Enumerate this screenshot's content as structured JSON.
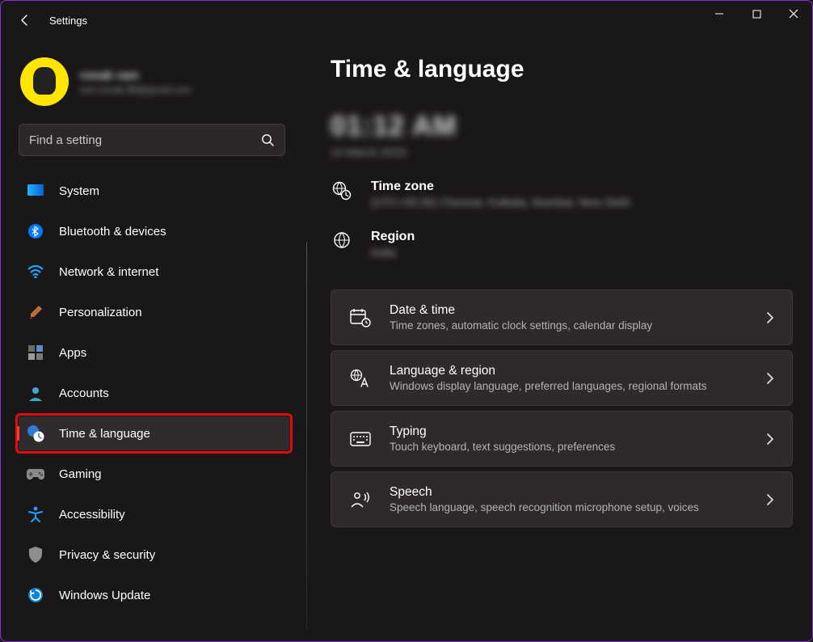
{
  "app": {
    "title": "Settings"
  },
  "user": {
    "name": "ronak ram",
    "email": "ram.ronak.98@gmail.com"
  },
  "search": {
    "placeholder": "Find a setting"
  },
  "sidebar": {
    "items": [
      {
        "label": "System"
      },
      {
        "label": "Bluetooth & devices"
      },
      {
        "label": "Network & internet"
      },
      {
        "label": "Personalization"
      },
      {
        "label": "Apps"
      },
      {
        "label": "Accounts"
      },
      {
        "label": "Time & language"
      },
      {
        "label": "Gaming"
      },
      {
        "label": "Accessibility"
      },
      {
        "label": "Privacy & security"
      },
      {
        "label": "Windows Update"
      }
    ],
    "selected_index": 6
  },
  "page": {
    "title": "Time & language",
    "clock": "01:12 AM",
    "date": "14 March 2023",
    "timezone": {
      "title": "Time zone",
      "value": "(UTC+05:30) Chennai, Kolkata, Mumbai, New Delhi"
    },
    "region": {
      "title": "Region",
      "value": "India"
    },
    "cards": [
      {
        "title": "Date & time",
        "sub": "Time zones, automatic clock settings, calendar display"
      },
      {
        "title": "Language & region",
        "sub": "Windows display language, preferred languages, regional formats"
      },
      {
        "title": "Typing",
        "sub": "Touch keyboard, text suggestions, preferences"
      },
      {
        "title": "Speech",
        "sub": "Speech language, speech recognition microphone setup, voices"
      }
    ]
  }
}
